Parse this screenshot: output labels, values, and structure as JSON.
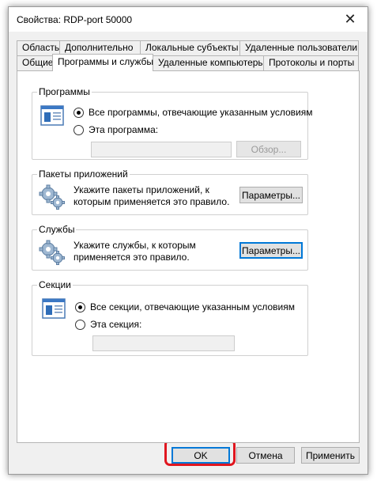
{
  "window": {
    "title": "Свойства: RDP-port 50000",
    "close_symbol": "✕"
  },
  "tabs": {
    "back_row": [
      "Область",
      "Дополнительно",
      "Локальные субъекты",
      "Удаленные пользователи"
    ],
    "front_row": [
      "Общие",
      "Программы и службы",
      "Удаленные компьютеры",
      "Протоколы и порты"
    ],
    "active": "Программы и службы"
  },
  "programs": {
    "title": "Программы",
    "option_all": "Все программы, отвечающие указанным условиям",
    "option_this": "Эта программа:",
    "path_value": "",
    "browse_label": "Обзор..."
  },
  "packages": {
    "title": "Пакеты приложений",
    "description_line1": "Укажите пакеты приложений, к",
    "description_line2": "которым применяется это правило.",
    "button_label": "Параметры..."
  },
  "services": {
    "title": "Службы",
    "description_line1": "Укажите службы, к которым",
    "description_line2": "применяется это правило.",
    "button_label": "Параметры..."
  },
  "sections": {
    "title": "Секции",
    "option_all": "Все секции, отвечающие указанным условиям",
    "option_this": "Эта секция:",
    "section_value": ""
  },
  "footer": {
    "ok_label": "OK",
    "cancel_label": "Отмена",
    "apply_label": "Применить"
  },
  "colors": {
    "highlight": "#e0161f",
    "focus": "#0078d7",
    "dialog_bg": "#f0f0f0"
  }
}
